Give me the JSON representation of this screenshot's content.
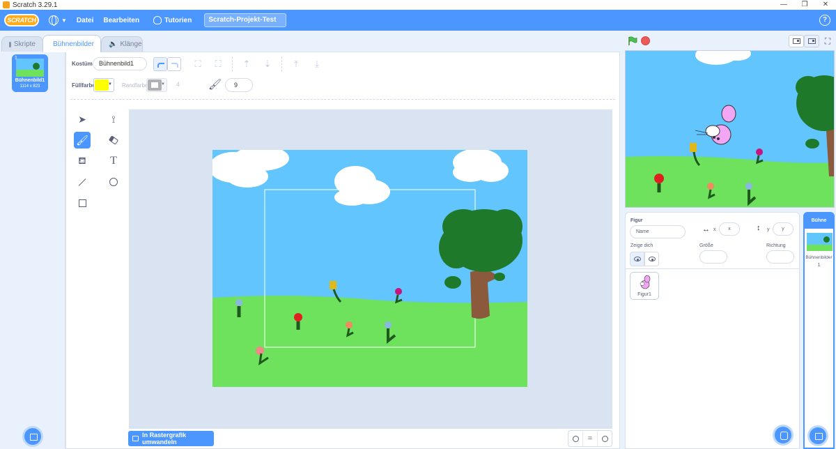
{
  "window": {
    "title": "Scratch 3.29.1",
    "controls": [
      "—",
      "❐",
      "✕"
    ]
  },
  "menubar": {
    "logo": "SCRATCH",
    "file": "Datei",
    "edit": "Bearbeiten",
    "tutorials": "Tutorien",
    "project_title": "Scratch-Projekt-Test",
    "help": "?"
  },
  "tabs": {
    "code": "Skripte",
    "costumes": "Bühnenbilder",
    "sounds": "Klänge",
    "active": "costumes"
  },
  "costumes": [
    {
      "number": "1",
      "name": "Bühnenbild1",
      "size": "1114 x 823"
    }
  ],
  "editor": {
    "costume_label": "Kostüm",
    "costume_name": "Bühnenbild1",
    "fill_label": "Füllfarbe",
    "fill_color": "#ffff00",
    "outline_label": "Randfarbe",
    "outline_width": "4",
    "brush_size": "9",
    "active_tool": "brush",
    "convert_button": "In Rastergrafik umwandeln",
    "zoom_reset": "="
  },
  "tools": [
    "select-icon",
    "reshape-icon",
    "brush-icon",
    "eraser-icon",
    "fill-icon",
    "text-icon",
    "line-icon",
    "circle-icon",
    "rectangle-icon"
  ],
  "sprite_info": {
    "title": "Figur",
    "name_placeholder": "Name",
    "x_label": "x",
    "x_placeholder": "x",
    "y_label": "y",
    "y_placeholder": "y",
    "show_label": "Zeige dich",
    "size_label": "Größe",
    "direction_label": "Richtung"
  },
  "sprites": [
    {
      "name": "Figur1"
    }
  ],
  "stage_panel": {
    "title": "Bühne",
    "backdrops_label": "Bühnenbilder",
    "backdrops_count": "1"
  },
  "colors": {
    "accent": "#4c97ff",
    "sky": "#63c5fe",
    "grass": "#6ee25d",
    "tree_leaves": "#1e7a2a",
    "trunk": "#8b5a3c"
  }
}
